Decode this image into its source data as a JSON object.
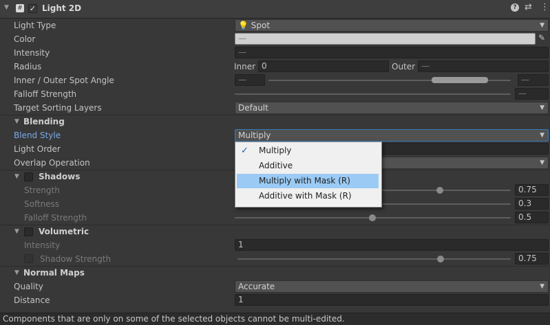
{
  "header": {
    "component_name": "Light 2D",
    "enabled": true,
    "icon_help": "help-icon",
    "icon_presets": "presets-icon",
    "icon_menu": "kebab-menu-icon"
  },
  "fields": {
    "light_type": {
      "label": "Light Type",
      "value": "Spot"
    },
    "color": {
      "label": "Color",
      "value": "—"
    },
    "intensity": {
      "label": "Intensity",
      "value": "—"
    },
    "radius": {
      "label": "Radius",
      "inner_label": "Inner",
      "inner_value": "0",
      "outer_label": "Outer",
      "outer_value": "—"
    },
    "spot_angle": {
      "label": "Inner / Outer Spot Angle",
      "min_value": "—",
      "max_value": "—"
    },
    "falloff": {
      "label": "Falloff Strength",
      "value": "—"
    },
    "sorting_layers": {
      "label": "Target Sorting Layers",
      "value": "Default"
    }
  },
  "blending": {
    "title": "Blending",
    "blend_style": {
      "label": "Blend Style",
      "value": "Multiply"
    },
    "light_order": {
      "label": "Light Order"
    },
    "overlap": {
      "label": "Overlap Operation"
    }
  },
  "blend_menu": {
    "items": [
      "Multiply",
      "Additive",
      "Multiply with Mask (R)",
      "Additive with Mask (R)"
    ],
    "selected": "Multiply",
    "highlighted": "Multiply with Mask (R)"
  },
  "shadows": {
    "title": "Shadows",
    "strength": {
      "label": "Strength",
      "value": "0.75"
    },
    "softness": {
      "label": "Softness",
      "value": "0.3"
    },
    "falloff": {
      "label": "Falloff Strength",
      "value": "0.5"
    }
  },
  "volumetric": {
    "title": "Volumetric",
    "intensity": {
      "label": "Intensity",
      "value": "1"
    },
    "shadow_strength": {
      "label": "Shadow Strength",
      "value": "0.75"
    }
  },
  "normal_maps": {
    "title": "Normal Maps",
    "quality": {
      "label": "Quality",
      "value": "Accurate"
    },
    "distance": {
      "label": "Distance",
      "value": "1"
    }
  },
  "footer": {
    "message": "Components that are only on some of the selected objects cannot be multi-edited."
  },
  "colors": {
    "accent_label": "#7ba8e6",
    "menu_highlight": "#9bcbf5"
  }
}
